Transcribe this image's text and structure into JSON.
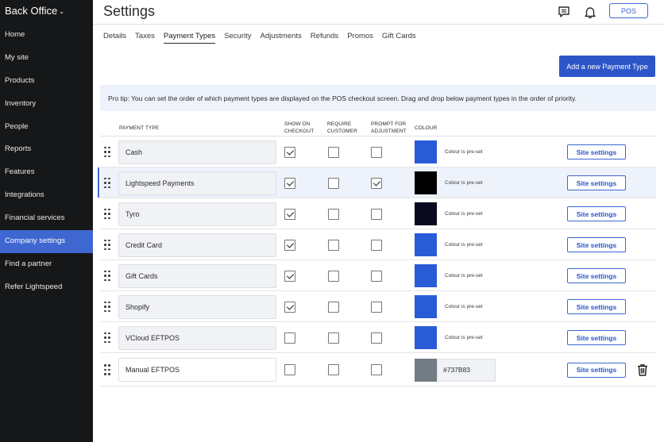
{
  "sidebar": {
    "brand": "Back Office",
    "items": [
      {
        "label": "Home"
      },
      {
        "label": "My site"
      },
      {
        "label": "Products"
      },
      {
        "label": "Inventory"
      },
      {
        "label": "People"
      },
      {
        "label": "Reports"
      },
      {
        "label": "Features"
      },
      {
        "label": "Integrations"
      },
      {
        "label": "Financial services"
      },
      {
        "label": "Company settings",
        "active": true
      },
      {
        "label": "Find a partner"
      },
      {
        "label": "Refer Lightspeed"
      }
    ]
  },
  "header": {
    "title": "Settings",
    "icons": [
      "chat-icon",
      "bell-icon"
    ],
    "pos_label": "POS"
  },
  "tabs": [
    {
      "label": "Details"
    },
    {
      "label": "Taxes"
    },
    {
      "label": "Payment Types",
      "active": true
    },
    {
      "label": "Security"
    },
    {
      "label": "Adjustments"
    },
    {
      "label": "Refunds"
    },
    {
      "label": "Promos"
    },
    {
      "label": "Gift Cards"
    }
  ],
  "add_button": "Add a new Payment Type",
  "tip": "Pro tip: You can set the order of which payment types are displayed on the POS checkout screen. Drag and drop below payment types in the order of priority.",
  "table": {
    "headers": {
      "payment_type": "PAYMENT TYPE",
      "show_on_checkout": "SHOW ON CHECKOUT",
      "require_customer": "REQUIRE CUSTOMER",
      "prompt_for_adjustment": "PROMPT FOR ADJUSTMENT",
      "colour": "COLOUR"
    },
    "rows": [
      {
        "name": "Cash",
        "show": true,
        "require": false,
        "prompt": false,
        "color": "#2A5BD7",
        "preset": "Colour is pre-set",
        "site": "Site settings"
      },
      {
        "name": "Lightspeed Payments",
        "show": true,
        "require": false,
        "prompt": true,
        "color": "#000000",
        "preset": "Colour is pre-set",
        "site": "Site settings"
      },
      {
        "name": "Tyro",
        "show": true,
        "require": false,
        "prompt": false,
        "color": "#0A0A1F",
        "preset": "Colour is pre-set",
        "site": "Site settings"
      },
      {
        "name": "Credit Card",
        "show": true,
        "require": false,
        "prompt": false,
        "color": "#2A5BD7",
        "preset": "Colour is pre-set",
        "site": "Site settings"
      },
      {
        "name": "Gift Cards",
        "show": true,
        "require": false,
        "prompt": false,
        "color": "#2A5BD7",
        "preset": "Colour is pre-set",
        "site": "Site settings"
      },
      {
        "name": "Shopify",
        "show": true,
        "require": false,
        "prompt": false,
        "color": "#2A5BD7",
        "preset": "Colour is pre-set",
        "site": "Site settings"
      },
      {
        "name": "VCloud EFTPOS",
        "show": false,
        "require": false,
        "prompt": false,
        "color": "#2A5BD7",
        "preset": "Colour is pre-set",
        "site": "Site settings"
      },
      {
        "name": "Manual EFTPOS",
        "show": false,
        "require": false,
        "prompt": false,
        "color": "#737B83",
        "hex": "#737B83",
        "site": "Site settings",
        "deletable": true
      }
    ]
  }
}
